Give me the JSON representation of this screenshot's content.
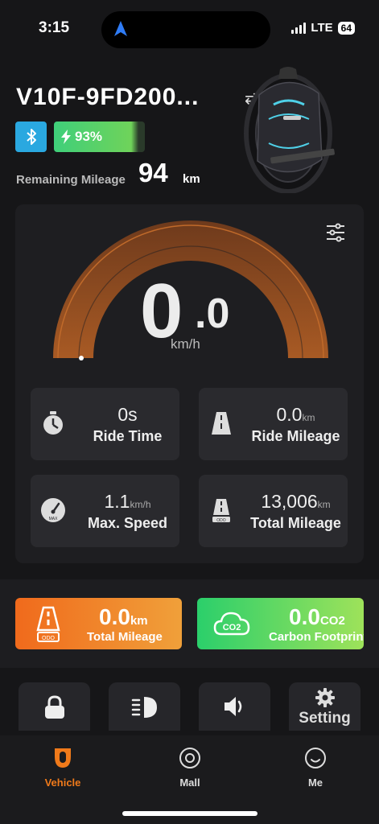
{
  "status_bar": {
    "time": "3:15",
    "network": "LTE",
    "battery": "64",
    "icons": [
      "location-arrow-icon",
      "signal-icon"
    ]
  },
  "device": {
    "name": "V10F-9FD200...",
    "battery_percent": "93%",
    "battery_level": 0.93,
    "remaining_label": "Remaining Mileage",
    "remaining_value": "94",
    "remaining_unit": "km"
  },
  "speed": {
    "integer": "0",
    "decimal": ".0",
    "unit": "km/h"
  },
  "stats": [
    {
      "value": "0s",
      "unit": "",
      "label": "Ride Time",
      "icon": "stopwatch-icon"
    },
    {
      "value": "0.0",
      "unit": "km",
      "label": "Ride Mileage",
      "icon": "road-icon"
    },
    {
      "value": "1.1",
      "unit": "km/h",
      "label": "Max. Speed",
      "icon": "speedometer-icon"
    },
    {
      "value": "13,006",
      "unit": "km",
      "label": "Total Mileage",
      "icon": "odometer-road-icon"
    }
  ],
  "promos": {
    "mileage": {
      "value": "0.0",
      "unit": "km",
      "label": "Total Mileage",
      "icon": "odometer-road-icon"
    },
    "carbon": {
      "value": "0.0",
      "unit": "CO2",
      "label": "Carbon Footprint",
      "icon_text": "CO2"
    }
  },
  "controls": {
    "setting_label": "Setting"
  },
  "nav": {
    "vehicle": "Vehicle",
    "mall": "Mall",
    "me": "Me"
  },
  "colors": {
    "accent": "#f07a1a",
    "bluetooth": "#2aa8e0",
    "battery": "#3fcf7a"
  }
}
